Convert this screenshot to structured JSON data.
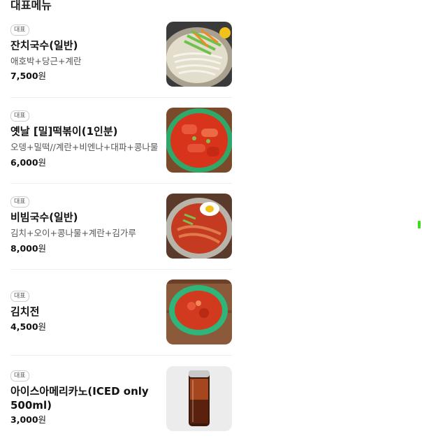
{
  "section": {
    "title": "대표메뉴"
  },
  "items": [
    {
      "badge": "대표",
      "name": "잔치국수(일반)",
      "desc": "애호박+당근+계란",
      "price": "7,500",
      "unit": "원"
    },
    {
      "badge": "대표",
      "name": "옛날 [밀]떡볶이(1인분)",
      "desc": "오뎅+밀떡//계란+비엔나+대파+콩나물",
      "price": "6,000",
      "unit": "원"
    },
    {
      "badge": "대표",
      "name": "비빔국수(일반)",
      "desc": "김치+오이+콩나물+계란+김가루",
      "price": "8,000",
      "unit": "원"
    },
    {
      "badge": "대표",
      "name": "김치전",
      "desc": "",
      "price": "4,500",
      "unit": "원"
    },
    {
      "badge": "대표",
      "name": "아이스아메리카노(ICED only 500ml)",
      "desc": "",
      "price": "3,000",
      "unit": "원"
    }
  ],
  "colors": {
    "scroll_indicator": "#3ddc1f",
    "divider": "#eeeeee"
  }
}
